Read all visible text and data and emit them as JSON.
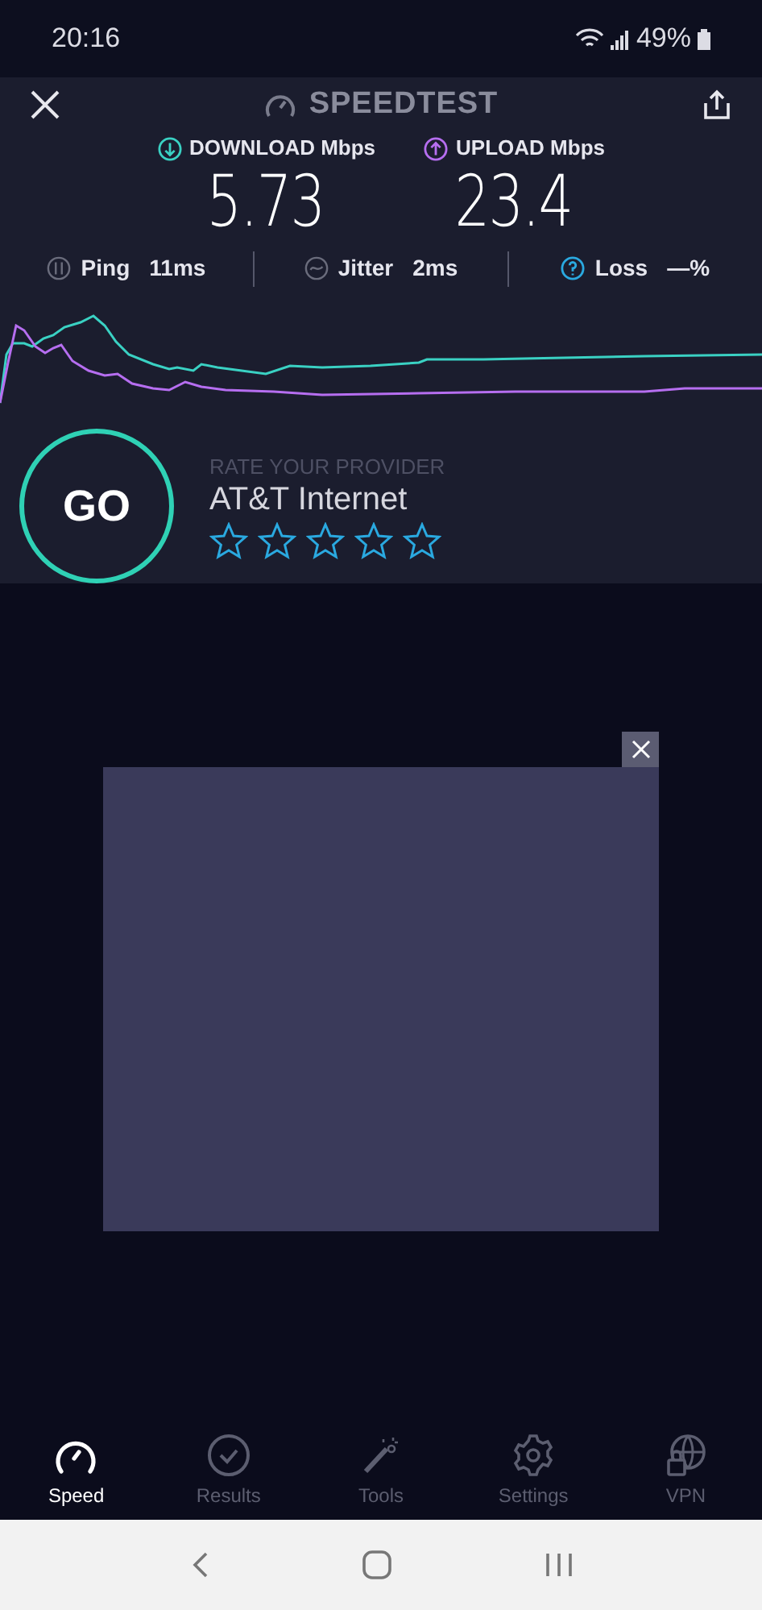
{
  "status_bar": {
    "time": "20:16",
    "battery": "49%"
  },
  "header": {
    "title": "SPEEDTEST"
  },
  "results": [
    {
      "kind": "download",
      "label": "DOWNLOAD Mbps",
      "value": "5.73",
      "color": "#3ad1c3"
    },
    {
      "kind": "upload",
      "label": "UPLOAD Mbps",
      "value": "23.4",
      "color": "#b66ef0"
    }
  ],
  "metrics": [
    {
      "kind": "ping",
      "label": "Ping",
      "value": "11ms"
    },
    {
      "kind": "jitter",
      "label": "Jitter",
      "value": "2ms"
    },
    {
      "kind": "loss",
      "label": "Loss",
      "value": "—%"
    }
  ],
  "go_button": {
    "label": "GO"
  },
  "rating": {
    "heading": "RATE YOUR PROVIDER",
    "provider": "AT&T Internet",
    "stars": 0
  },
  "tabs": [
    {
      "kind": "speed",
      "label": "Speed",
      "selected": true
    },
    {
      "kind": "results",
      "label": "Results",
      "selected": false
    },
    {
      "kind": "tools",
      "label": "Tools",
      "selected": false
    },
    {
      "kind": "settings",
      "label": "Settings",
      "selected": false
    },
    {
      "kind": "vpn",
      "label": "VPN",
      "selected": false
    }
  ]
}
